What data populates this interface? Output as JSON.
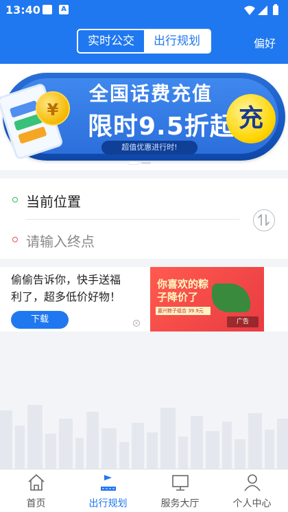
{
  "status_bar": {
    "time": "13:40",
    "badge": "A"
  },
  "header": {
    "tabs": [
      {
        "label": "实时公交",
        "active": false
      },
      {
        "label": "出行规划",
        "active": true
      }
    ],
    "preferences": "偏好"
  },
  "banner": {
    "title": "全国话费充值",
    "subtitle": "限时9.5折起",
    "note": "超值优惠进行时!",
    "coin_symbol": "¥",
    "badge": "充",
    "slide_index": 1,
    "slide_count": 2
  },
  "route": {
    "origin": "当前位置",
    "destination_placeholder": "请输入终点"
  },
  "ad": {
    "text": "偷偷告诉你，快手送福利了，超多低价好物！",
    "download_label": "下载",
    "image_headline": "你喜欢的粽子降价了",
    "image_chip": "嘉兴粽子组合 39.9元",
    "ad_label": "广告"
  },
  "tabbar": {
    "items": [
      {
        "label": "首页",
        "icon": "home-icon",
        "active": false
      },
      {
        "label": "出行规划",
        "icon": "route-plan-icon",
        "active": true
      },
      {
        "label": "服务大厅",
        "icon": "monitor-icon",
        "active": false
      },
      {
        "label": "个人中心",
        "icon": "user-icon",
        "active": false
      }
    ]
  },
  "colors": {
    "brand": "#1f78f0",
    "start_dot": "#2dbb5d",
    "end_dot": "#e0524c"
  }
}
